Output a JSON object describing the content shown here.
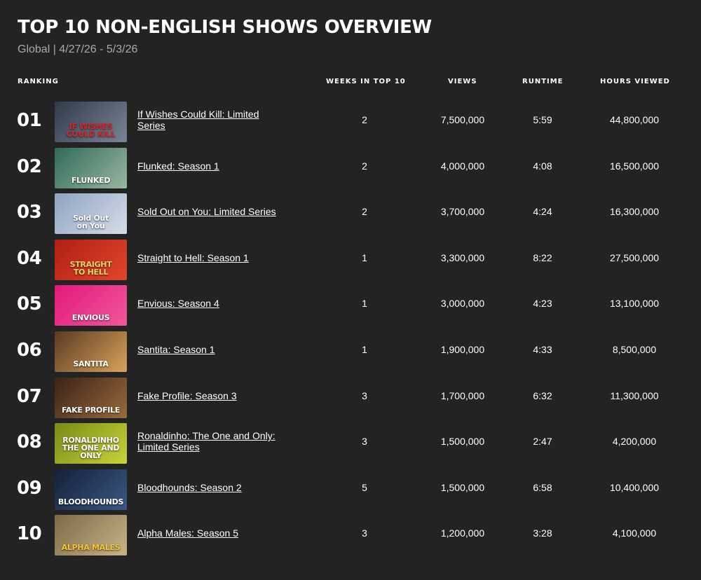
{
  "page": {
    "title": "TOP 10 NON-ENGLISH SHOWS OVERVIEW",
    "subtitle": "Global | 4/27/26 - 5/3/26"
  },
  "headers": {
    "ranking": "RANKING",
    "weeks": "WEEKS IN TOP 10",
    "views": "VIEWS",
    "runtime": "RUNTIME",
    "hours": "HOURS VIEWED"
  },
  "rows": [
    {
      "rank": "01",
      "show": "If Wishes Could Kill: Limited Series",
      "weeks": "2",
      "views": "7,500,000",
      "runtime": "5:59",
      "hours": "44,800,000",
      "thumb_text": "IF WISHES\nCOULD KILL",
      "thumb_colors": [
        "#2f3a4a",
        "#7a8696"
      ],
      "thumb_text_color": "#d8242b"
    },
    {
      "rank": "02",
      "show": "Flunked: Season 1",
      "weeks": "2",
      "views": "4,000,000",
      "runtime": "4:08",
      "hours": "16,500,000",
      "thumb_text": "FLUNKED",
      "thumb_colors": [
        "#2e6a5a",
        "#9bb7a0"
      ],
      "thumb_text_color": "#ffffff"
    },
    {
      "rank": "03",
      "show": "Sold Out on You: Limited Series",
      "weeks": "2",
      "views": "3,700,000",
      "runtime": "4:24",
      "hours": "16,300,000",
      "thumb_text": "Sold Out\non You",
      "thumb_colors": [
        "#8ea3c2",
        "#d6dde8"
      ],
      "thumb_text_color": "#ffffff"
    },
    {
      "rank": "04",
      "show": "Straight to Hell: Season 1",
      "weeks": "1",
      "views": "3,300,000",
      "runtime": "8:22",
      "hours": "27,500,000",
      "thumb_text": "STRAIGHT\nTO HELL",
      "thumb_colors": [
        "#b01e14",
        "#e0462a"
      ],
      "thumb_text_color": "#f6d36b"
    },
    {
      "rank": "05",
      "show": "Envious: Season 4",
      "weeks": "1",
      "views": "3,000,000",
      "runtime": "4:23",
      "hours": "13,100,000",
      "thumb_text": "ENVIOUS",
      "thumb_colors": [
        "#e2187a",
        "#f0589c"
      ],
      "thumb_text_color": "#ffffff"
    },
    {
      "rank": "06",
      "show": "Santita: Season 1",
      "weeks": "1",
      "views": "1,900,000",
      "runtime": "4:33",
      "hours": "8,500,000",
      "thumb_text": "SANTITA",
      "thumb_colors": [
        "#5a3a24",
        "#d9a35a"
      ],
      "thumb_text_color": "#ffffff"
    },
    {
      "rank": "07",
      "show": "Fake Profile: Season 3",
      "weeks": "3",
      "views": "1,700,000",
      "runtime": "6:32",
      "hours": "11,300,000",
      "thumb_text": "FAKE PROFILE",
      "thumb_colors": [
        "#3a2318",
        "#9a6a3a"
      ],
      "thumb_text_color": "#ffffff"
    },
    {
      "rank": "08",
      "show": "Ronaldinho: The One and Only: Limited Series",
      "weeks": "3",
      "views": "1,500,000",
      "runtime": "2:47",
      "hours": "4,200,000",
      "thumb_text": "RONALDINHO\nTHE ONE AND ONLY",
      "thumb_colors": [
        "#7a8a18",
        "#c7d43a"
      ],
      "thumb_text_color": "#ffffff"
    },
    {
      "rank": "09",
      "show": "Bloodhounds: Season 2",
      "weeks": "5",
      "views": "1,500,000",
      "runtime": "6:58",
      "hours": "10,400,000",
      "thumb_text": "BLOODHOUNDS",
      "thumb_colors": [
        "#142038",
        "#3a5884"
      ],
      "thumb_text_color": "#ffffff"
    },
    {
      "rank": "10",
      "show": "Alpha Males: Season 5",
      "weeks": "3",
      "views": "1,200,000",
      "runtime": "3:28",
      "hours": "4,100,000",
      "thumb_text": "ALPHA MALES",
      "thumb_colors": [
        "#7c6a48",
        "#c9b488"
      ],
      "thumb_text_color": "#f4c930"
    }
  ]
}
